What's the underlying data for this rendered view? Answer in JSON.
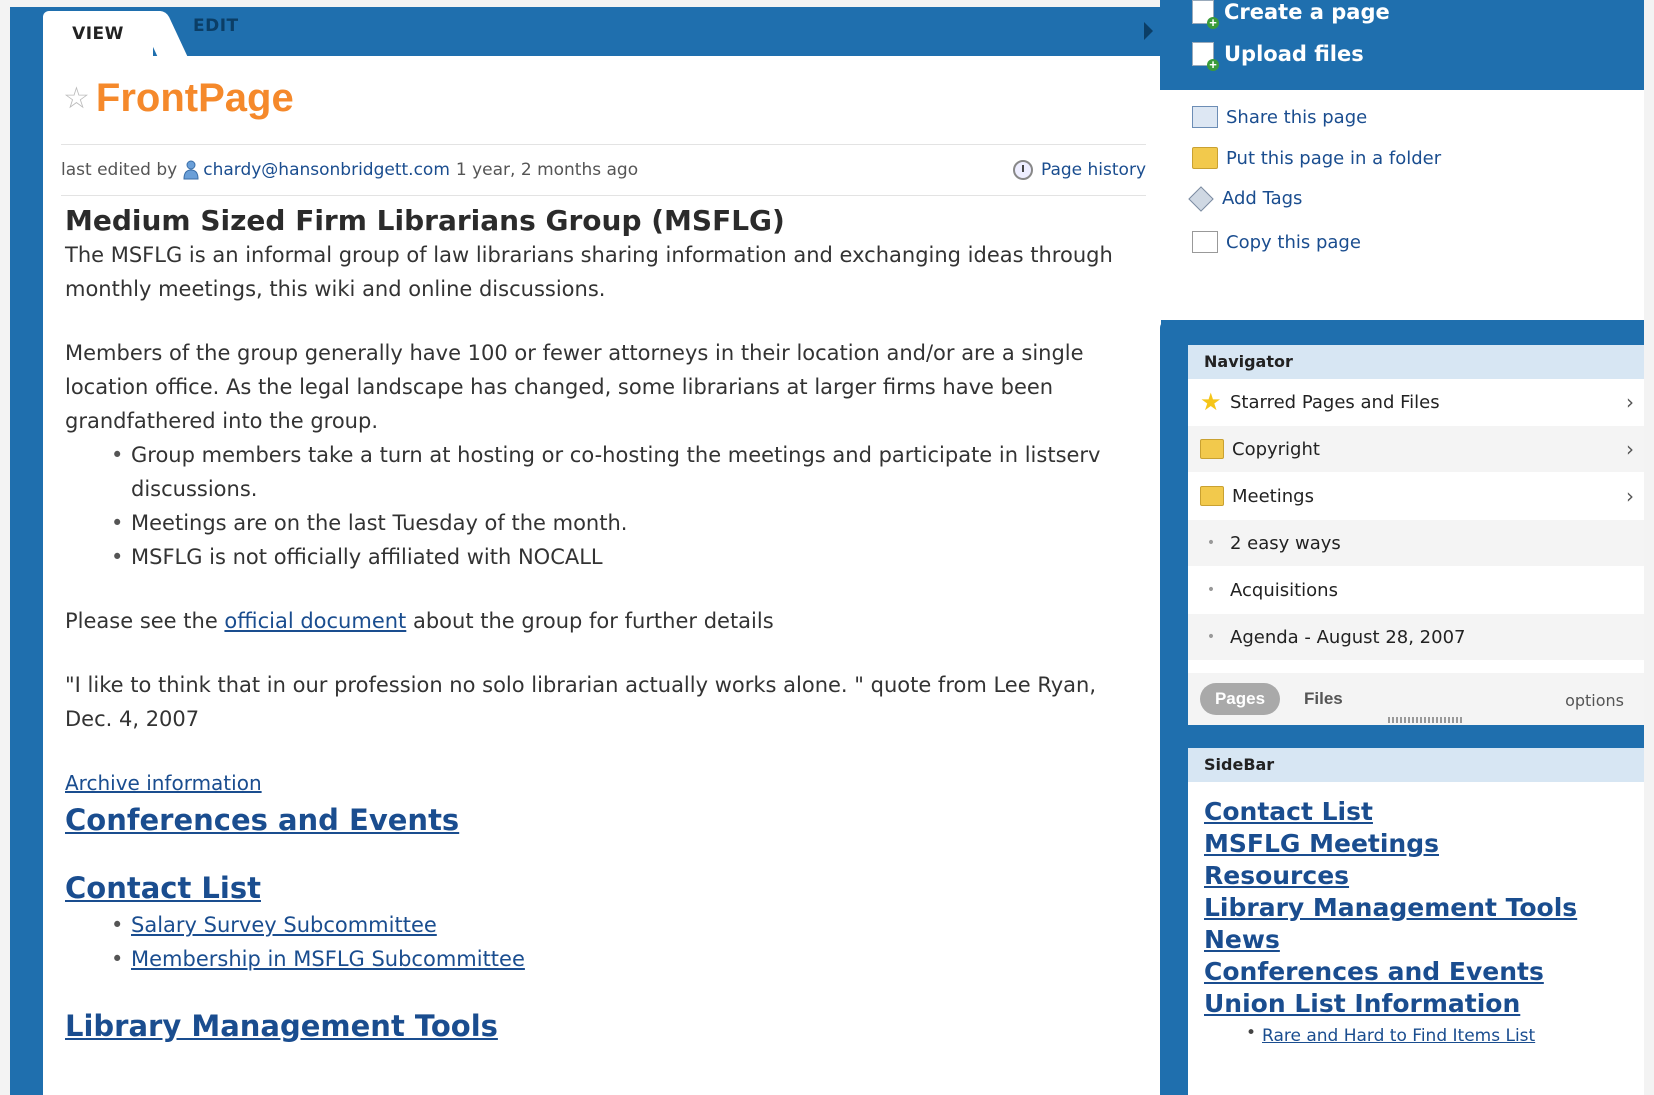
{
  "tabs": {
    "view": "VIEW",
    "edit": "EDIT"
  },
  "page": {
    "title": "FrontPage",
    "meta": {
      "prefix": "last edited by",
      "user": "chardy@hansonbridgett.com",
      "time": "1 year, 2 months ago",
      "history": "Page history"
    }
  },
  "content": {
    "heading": "Medium Sized Firm Librarians Group (MSFLG)",
    "intro": "The MSFLG is an informal group of law librarians sharing information and exchanging ideas through monthly meetings, this wiki and online discussions.",
    "members": "Members of the group generally have 100 or fewer attorneys in their location and/or are a single location office. As the legal landscape has changed, some librarians at larger firms have been grandfathered into the group.",
    "bullets": [
      "Group members take a turn at hosting or co-hosting the meetings and participate in listserv discussions.",
      "Meetings are on the last Tuesday of the month.",
      "MSFLG is not officially affiliated with NOCALL"
    ],
    "see_pre": "Please see the ",
    "see_link": "official document",
    "see_post": " about the group for further details",
    "quote": "\"I like to think that in our profession no solo librarian actually works alone. \" quote from Lee Ryan, Dec. 4, 2007",
    "archive": "Archive information",
    "conferences": "Conferences and Events",
    "contact": "Contact List",
    "contact_sub": [
      "Salary Survey Subcommittee",
      "Membership in MSFLG Subcommittee"
    ],
    "library": "Library Management Tools"
  },
  "right": {
    "create": "Create a page",
    "upload": "Upload files",
    "actions": [
      "Share this page",
      "Put this page in a folder",
      "Add Tags",
      "Copy this page"
    ]
  },
  "navigator": {
    "title": "Navigator",
    "rows": [
      {
        "label": "Starred Pages and Files",
        "icon": "star-icon"
      },
      {
        "label": "Copyright",
        "icon": "folder-icon"
      },
      {
        "label": "Meetings",
        "icon": "folder-icon"
      },
      {
        "label": "2 easy ways",
        "icon": "bullet"
      },
      {
        "label": "Acquisitions",
        "icon": "bullet"
      },
      {
        "label": "Agenda - August 28, 2007",
        "icon": "bullet"
      }
    ],
    "pages_tab": "Pages",
    "files_tab": "Files",
    "options": "options"
  },
  "sidebar": {
    "title": "SideBar",
    "links": [
      "Contact List",
      "MSFLG Meetings",
      "Resources",
      "Library Management Tools",
      "News",
      "Conferences and Events",
      "Union List Information"
    ],
    "sub": [
      "Rare and Hard to Find Items List"
    ]
  },
  "colors": {
    "accent_blue": "#1f6fae",
    "title_orange": "#f5892b",
    "link_blue": "#1a4d8f"
  }
}
